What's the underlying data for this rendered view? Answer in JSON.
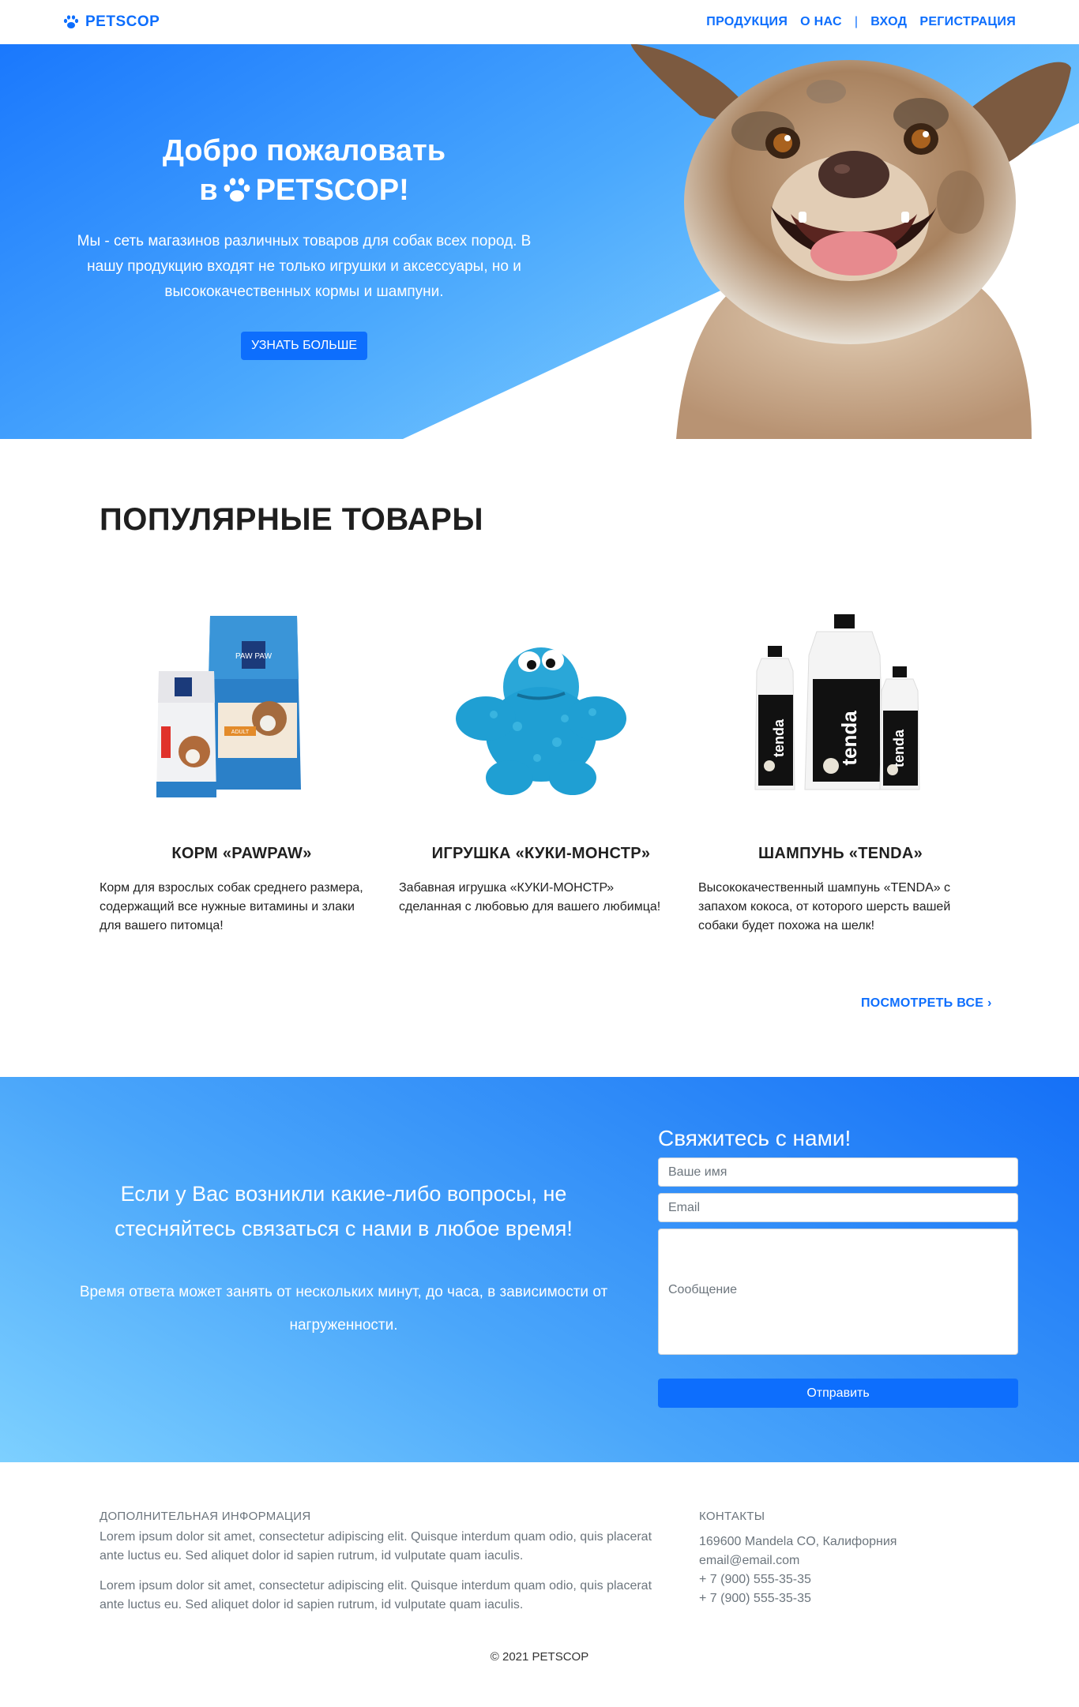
{
  "colors": {
    "accent": "#0d6efd",
    "hero_gradient_from": "#1e7dfd",
    "hero_gradient_to": "#7ccafe",
    "contact_gradient": "#3d9bfa"
  },
  "nav": {
    "brand": "PETSCOP",
    "links": [
      "ПРОДУКЦИЯ",
      "О НАС",
      "ВХОД",
      "РЕГИСТРАЦИЯ"
    ],
    "separator": "|"
  },
  "hero": {
    "title_line1": "Добро пожаловать",
    "title_prefix": "в",
    "title_brand": "PETSCOP!",
    "description": "Мы - сеть магазинов различных товаров для собак всех пород. В нашу продукцию входят не только игрушки и аксессуары, но и высококачественных кормы и шампуни.",
    "button": "УЗНАТЬ БОЛЬШЕ"
  },
  "popular": {
    "title": "ПОПУЛЯРНЫЕ ТОВАРЫ",
    "products": [
      {
        "name": "КОРМ «PAWPAW»",
        "desc": "Корм для взрослых собак среднего размера, содержащий все нужные витамины и злаки для вашего питомца!",
        "package_brand": "PAW PAW",
        "package_label": "ADULT"
      },
      {
        "name": "ИГРУШКА «КУКИ-МОНСТР»",
        "desc": "Забавная игрушка «КУКИ-МОНСТР» сделанная с любовью для вашего любимца!"
      },
      {
        "name": "ШАМПУНЬ «TENDA»",
        "desc": "Высококачественный шампунь «TENDA» с запахом кокоса, от которого шерсть вашей собаки будет похожа на шелк!",
        "bottle_label": "tenda"
      }
    ],
    "see_all": "ПОСМОТРЕТЬ ВСЕ ›"
  },
  "contact": {
    "lead": "Если у Вас возникли какие-либо вопросы, не стесняйтесь связаться с нами в любое время!",
    "sub": "Время ответа может занять от нескольких минут, до часа, в зависимости от нагруженности.",
    "form_title": "Свяжитесь с нами!",
    "name_placeholder": "Ваше имя",
    "email_placeholder": "Email",
    "message_placeholder": "Сообщение",
    "submit": "Отправить"
  },
  "footer": {
    "info_heading": "ДОПОЛНИТЕЛЬНАЯ ИНФОРМАЦИЯ",
    "info_p1": "Lorem ipsum dolor sit amet, consectetur adipiscing elit. Quisque interdum quam odio, quis placerat ante luctus eu. Sed aliquet dolor id sapien rutrum, id vulputate quam iaculis.",
    "info_p2": "Lorem ipsum dolor sit amet, consectetur adipiscing elit. Quisque interdum quam odio, quis placerat ante luctus eu. Sed aliquet dolor id sapien rutrum, id vulputate quam iaculis.",
    "contacts_heading": "КОНТАКТЫ",
    "address": "169600 Mandela CO, Калифорния",
    "email": "email@email.com",
    "phone1": "+ 7 (900) 555-35-35",
    "phone2": "+ 7 (900) 555-35-35",
    "copyright": "© 2021 PETSCOP"
  }
}
